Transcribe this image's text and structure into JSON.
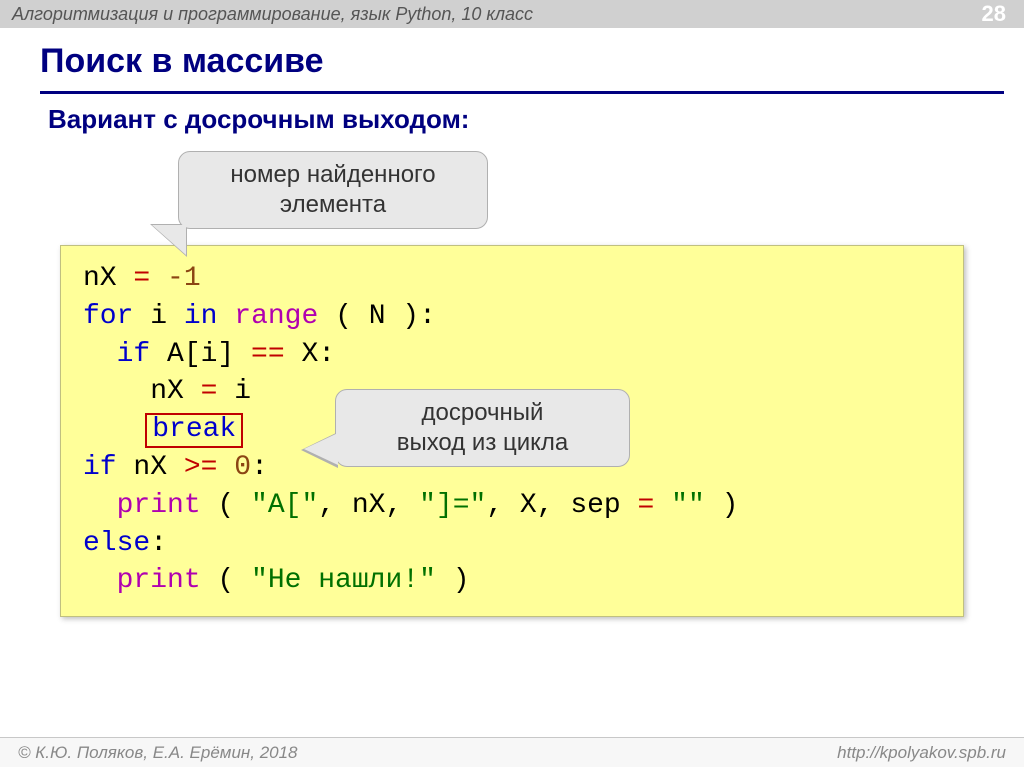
{
  "header": {
    "title": "Алгоритмизация и программирование, язык Python, 10 класс",
    "page": "28"
  },
  "titles": {
    "main": "Поиск в массиве",
    "sub": "Вариант с досрочным выходом:"
  },
  "bubbles": {
    "found_index": "номер найденного\nэлемента",
    "early_exit": "досрочный\nвыход из цикла"
  },
  "code": {
    "l1a": "nX ",
    "l1b": "=",
    "l1c": " ",
    "l1d": "-1",
    "l2a": "for",
    "l2b": " i ",
    "l2c": "in",
    "l2d": " ",
    "l2e": "range",
    "l2f": " ( N ):",
    "l3a": "  ",
    "l3b": "if",
    "l3c": " A[i] ",
    "l3d": "==",
    "l3e": " X:",
    "l4a": "    nX ",
    "l4b": "=",
    "l4c": " i",
    "l5a": "    ",
    "l5b": "break",
    "l6a": "if",
    "l6b": " nX ",
    "l6c": ">=",
    "l6d": " ",
    "l6e": "0",
    "l6f": ":",
    "l7a": "  ",
    "l7b": "print",
    "l7c": " ( ",
    "l7d": "\"A[\"",
    "l7e": ", nX, ",
    "l7f": "\"]=\"",
    "l7g": ", X, sep ",
    "l7h": "=",
    "l7i": " ",
    "l7j": "\"\"",
    "l7k": " )",
    "l8a": "else",
    "l8b": ":",
    "l9a": "  ",
    "l9b": "print",
    "l9c": " ( ",
    "l9d": "\"Не нашли!\"",
    "l9e": " )"
  },
  "footer": {
    "left": "© К.Ю. Поляков, Е.А. Ерёмин, 2018",
    "right": "http://kpolyakov.spb.ru"
  }
}
